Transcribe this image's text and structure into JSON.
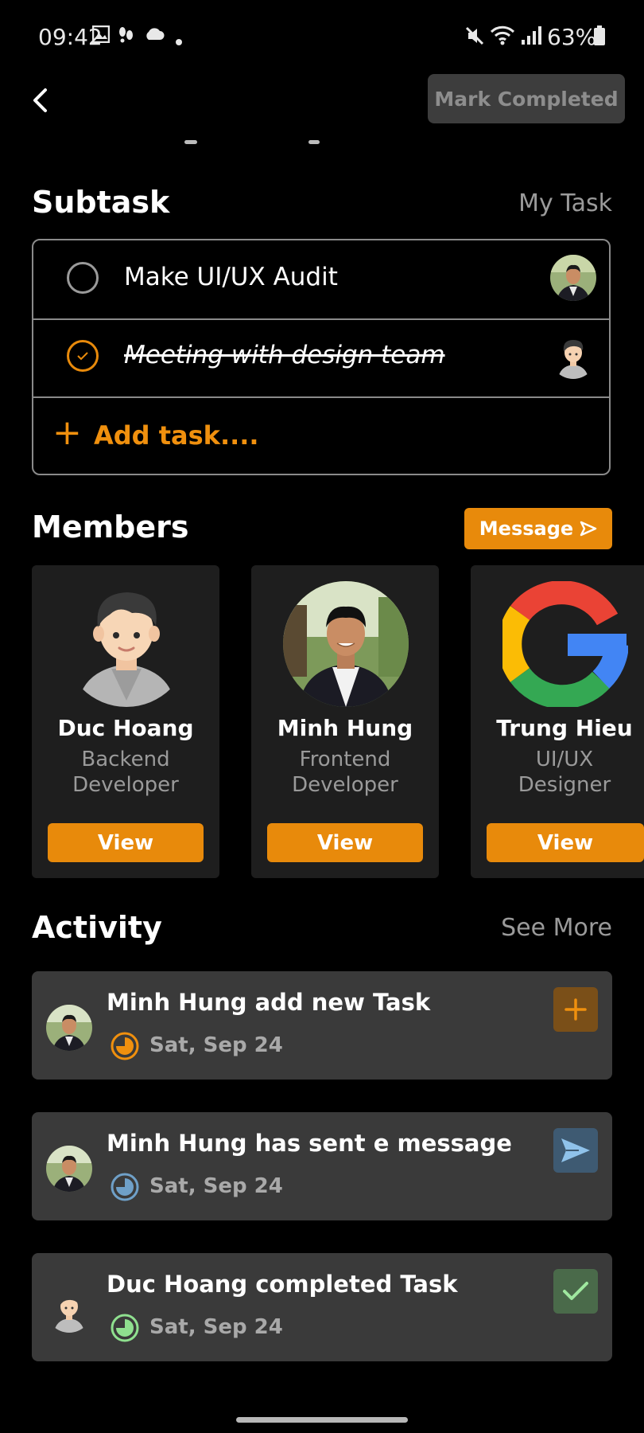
{
  "status_bar": {
    "time": "09:42",
    "battery": "63%"
  },
  "header": {
    "mark_completed": "Mark Completed"
  },
  "subtask": {
    "title": "Subtask",
    "link": "My Task",
    "items": [
      {
        "label": "Make UI/UX Audit",
        "completed": false
      },
      {
        "label": "Meeting with design team",
        "completed": true
      }
    ],
    "add_label": "Add task....",
    "add_icon": "+"
  },
  "members": {
    "title": "Members",
    "message_label": "Message",
    "list": [
      {
        "name": "Duc Hoang",
        "role_line1": "Backend",
        "role_line2": "Developer",
        "button": "View"
      },
      {
        "name": "Minh Hung",
        "role_line1": "Frontend",
        "role_line2": "Developer",
        "button": "View"
      },
      {
        "name": "Trung Hieu",
        "role_line1": "UI/UX",
        "role_line2": "Designer",
        "button": "View"
      }
    ]
  },
  "activity": {
    "title": "Activity",
    "link": "See More",
    "items": [
      {
        "text": "Minh Hung add new Task",
        "date": "Sat, Sep 24",
        "icon": "plus-icon",
        "accent": "#f0900e"
      },
      {
        "text": "Minh Hung has sent e message",
        "date": "Sat, Sep 24",
        "icon": "send-icon",
        "accent": "#6fa0c8"
      },
      {
        "text": "Duc Hoang completed Task",
        "date": "Sat, Sep 24",
        "icon": "check-icon",
        "accent": "#8fe08f"
      }
    ]
  },
  "colors": {
    "accent": "#e88a0b",
    "background": "#000000",
    "card": "#1e1e1e",
    "activity_card": "#3a3a3a"
  }
}
